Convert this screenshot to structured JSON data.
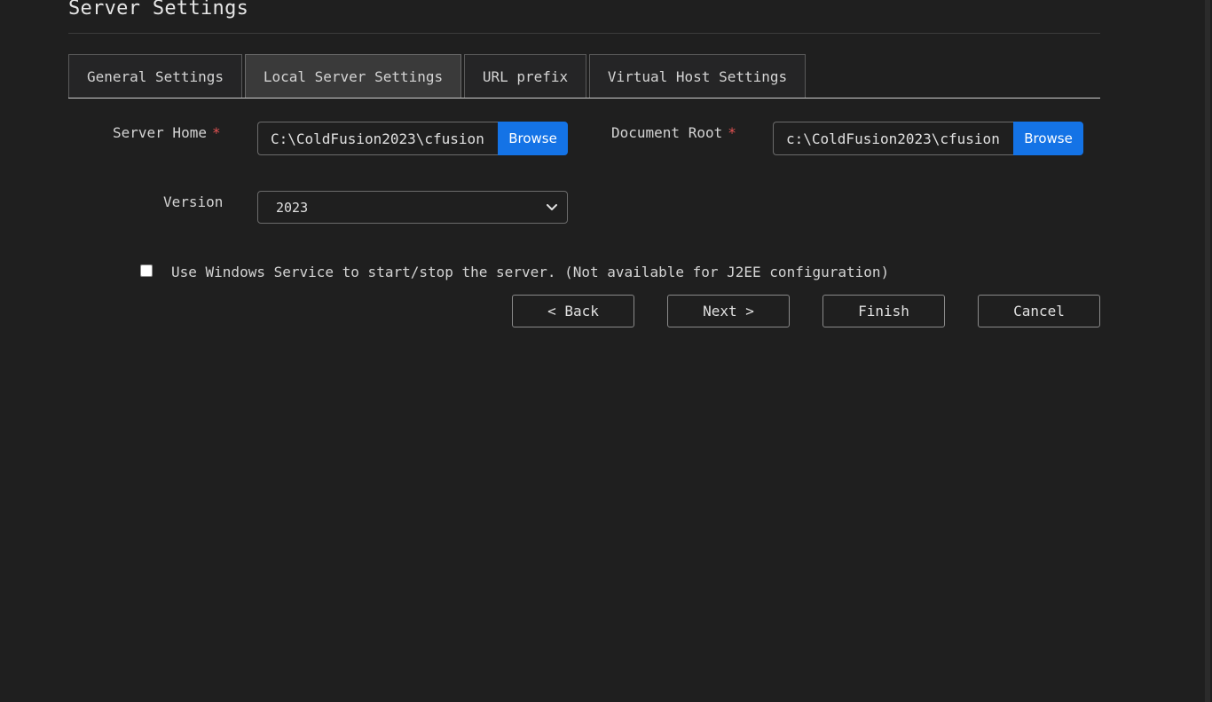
{
  "page": {
    "title": "Server Settings"
  },
  "tabs": [
    {
      "label": "General Settings",
      "active": false
    },
    {
      "label": "Local Server Settings",
      "active": true
    },
    {
      "label": "URL prefix",
      "active": false
    },
    {
      "label": "Virtual Host Settings",
      "active": false
    }
  ],
  "server_home": {
    "label": "Server Home",
    "required_mark": "*",
    "value": "C:\\ColdFusion2023\\cfusion",
    "browse_label": "Browse"
  },
  "document_root": {
    "label": "Document Root",
    "required_mark": "*",
    "value": "c:\\ColdFusion2023\\cfusion",
    "browse_label": "Browse"
  },
  "version": {
    "label": "Version",
    "selected": "2023"
  },
  "windows_service": {
    "checked": false,
    "label": "Use Windows Service to start/stop the server. (Not available for J2EE configuration)"
  },
  "buttons": {
    "back": "< Back",
    "next": "Next >",
    "finish": "Finish",
    "cancel": "Cancel"
  },
  "colors": {
    "background": "#1f1f1f",
    "accent": "#1473e6",
    "required": "#e05252"
  }
}
